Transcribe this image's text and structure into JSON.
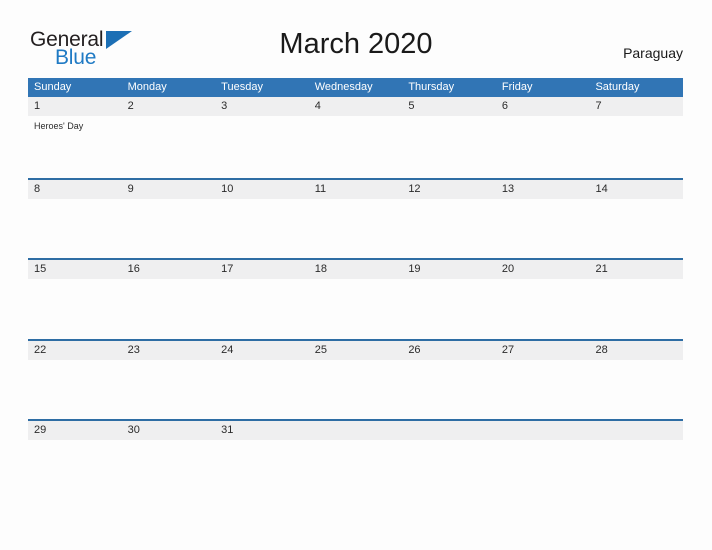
{
  "brand": {
    "name_part1": "General",
    "name_part2": "Blue",
    "flag_icon": "blue-triangle-flag-icon",
    "color_dark": "#231f20",
    "color_blue": "#1f7ac4"
  },
  "header": {
    "title": "March 2020",
    "country": "Paraguay"
  },
  "theme": {
    "header_blue": "#3175b5",
    "row_rule_blue": "#2e6da4",
    "date_band_gray": "#efeff0",
    "page_background": "#fdfdfd",
    "text_dark": "#2b2b2b"
  },
  "calendar": {
    "month": "March",
    "year": "2020",
    "weekdays": [
      "Sunday",
      "Monday",
      "Tuesday",
      "Wednesday",
      "Thursday",
      "Friday",
      "Saturday"
    ],
    "weeks": [
      [
        {
          "day": "1",
          "events": [
            "Heroes' Day"
          ]
        },
        {
          "day": "2",
          "events": []
        },
        {
          "day": "3",
          "events": []
        },
        {
          "day": "4",
          "events": []
        },
        {
          "day": "5",
          "events": []
        },
        {
          "day": "6",
          "events": []
        },
        {
          "day": "7",
          "events": []
        }
      ],
      [
        {
          "day": "8",
          "events": []
        },
        {
          "day": "9",
          "events": []
        },
        {
          "day": "10",
          "events": []
        },
        {
          "day": "11",
          "events": []
        },
        {
          "day": "12",
          "events": []
        },
        {
          "day": "13",
          "events": []
        },
        {
          "day": "14",
          "events": []
        }
      ],
      [
        {
          "day": "15",
          "events": []
        },
        {
          "day": "16",
          "events": []
        },
        {
          "day": "17",
          "events": []
        },
        {
          "day": "18",
          "events": []
        },
        {
          "day": "19",
          "events": []
        },
        {
          "day": "20",
          "events": []
        },
        {
          "day": "21",
          "events": []
        }
      ],
      [
        {
          "day": "22",
          "events": []
        },
        {
          "day": "23",
          "events": []
        },
        {
          "day": "24",
          "events": []
        },
        {
          "day": "25",
          "events": []
        },
        {
          "day": "26",
          "events": []
        },
        {
          "day": "27",
          "events": []
        },
        {
          "day": "28",
          "events": []
        }
      ],
      [
        {
          "day": "29",
          "events": []
        },
        {
          "day": "30",
          "events": []
        },
        {
          "day": "31",
          "events": []
        },
        {
          "day": "",
          "events": []
        },
        {
          "day": "",
          "events": []
        },
        {
          "day": "",
          "events": []
        },
        {
          "day": "",
          "events": []
        }
      ]
    ]
  }
}
